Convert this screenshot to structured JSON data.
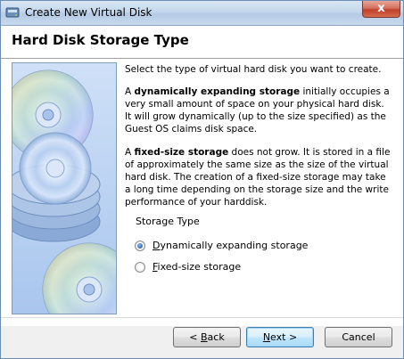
{
  "window": {
    "title": "Create New Virtual Disk",
    "close_glyph": "x"
  },
  "header": {
    "title": "Hard Disk Storage Type"
  },
  "content": {
    "intro": "Select the type of virtual hard disk you want to create.",
    "dynamic_prefix": "A ",
    "dynamic_bold": "dynamically expanding storage",
    "dynamic_text": " initially occupies a very small amount of space on your physical hard disk. It will grow dynamically (up to the size specified) as the Guest OS claims disk space.",
    "fixed_prefix": "A ",
    "fixed_bold": "fixed-size storage",
    "fixed_text": " does not grow. It is stored in a file of approximately the same size as the size of the virtual hard disk. The creation of a fixed-size storage may take a long time depending on the storage size and the write performance of your harddisk."
  },
  "storage_type": {
    "group_label": "Storage Type",
    "options": [
      {
        "accel": "D",
        "rest": "ynamically expanding storage",
        "selected": true
      },
      {
        "accel": "F",
        "rest": "ixed-size storage",
        "selected": false
      }
    ]
  },
  "buttons": {
    "back_prefix": "< ",
    "back_accel": "B",
    "back_rest": "ack",
    "next_accel": "N",
    "next_rest": "ext >",
    "cancel": "Cancel"
  },
  "icons": {
    "title_icon": "virtualbox-disk-icon",
    "side_image": "stacked-discs-illustration"
  }
}
